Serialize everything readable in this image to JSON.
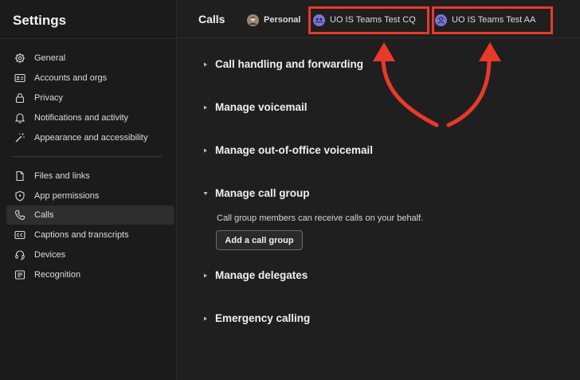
{
  "sidebar": {
    "title": "Settings",
    "items": [
      {
        "label": "General",
        "icon": "gear-icon"
      },
      {
        "label": "Accounts and orgs",
        "icon": "id-card-icon"
      },
      {
        "label": "Privacy",
        "icon": "lock-icon"
      },
      {
        "label": "Notifications and activity",
        "icon": "bell-icon"
      },
      {
        "label": "Appearance and accessibility",
        "icon": "magic-wand-icon"
      },
      {
        "label": "Files and links",
        "icon": "document-icon"
      },
      {
        "label": "App permissions",
        "icon": "shield-icon"
      },
      {
        "label": "Calls",
        "icon": "phone-icon",
        "selected": true
      },
      {
        "label": "Captions and transcripts",
        "icon": "cc-icon"
      },
      {
        "label": "Devices",
        "icon": "headset-icon"
      },
      {
        "label": "Recognition",
        "icon": "contact-card-icon"
      }
    ]
  },
  "header": {
    "title": "Calls",
    "tabs": [
      {
        "label": "Personal",
        "icon": "user-avatar-icon"
      },
      {
        "label": "UO IS Teams Test CQ",
        "icon": "call-queue-icon"
      },
      {
        "label": "UO IS Teams Test AA",
        "icon": "auto-attendant-icon"
      }
    ]
  },
  "main": {
    "sections": [
      {
        "label": "Call handling and forwarding",
        "expanded": false
      },
      {
        "label": "Manage voicemail",
        "expanded": false
      },
      {
        "label": "Manage out-of-office voicemail",
        "expanded": false
      },
      {
        "label": "Manage call group",
        "expanded": true
      },
      {
        "label": "Manage delegates",
        "expanded": false
      },
      {
        "label": "Emergency calling",
        "expanded": false
      }
    ],
    "call_group_description": "Call group members can receive calls on your behalf.",
    "add_call_group_label": "Add a call group"
  },
  "colors": {
    "background": "#1f1f1f",
    "sidebar_background": "#1b1b1b",
    "highlight": "#e8392a",
    "bot_avatar": "#7b74d6"
  }
}
